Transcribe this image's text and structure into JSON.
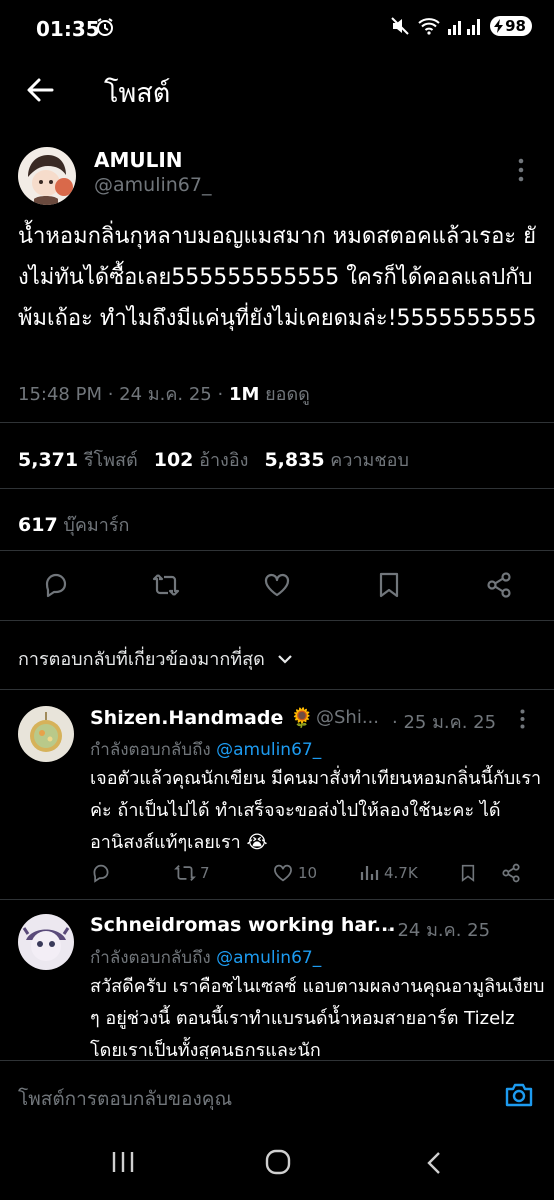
{
  "status_bar": {
    "time": "01:35",
    "battery": "98"
  },
  "header": {
    "title": "โพสต์"
  },
  "post": {
    "author_name": "AMULIN",
    "author_handle": "@amulin67_",
    "text": "น้ำหอมกลิ่นกุหลาบมอญแมสมาก หมดสตอคแล้วเรอะ ยังไม่ทันได้ซื้อเลย555555555555 ใครก็ได้คอลแลปกับพ้มเถ้อะ ทำไมถึงมีแค่นุที่ยังไม่เคยดมล่ะ!5555555555",
    "time": "15:48 PM · 24 ม.ค. 25 ·",
    "views_count": "1M",
    "views_label": "ยอดดู"
  },
  "stats": {
    "reposts_count": "5,371",
    "reposts_label": "รีโพสต์",
    "quotes_count": "102",
    "quotes_label": "อ้างอิง",
    "likes_count": "5,835",
    "likes_label": "ความชอบ",
    "bookmarks_count": "617",
    "bookmarks_label": "บุ๊คมาร์ก"
  },
  "sort_label": "การตอบกลับที่เกี่ยวข้องมากที่สุด",
  "replies": [
    {
      "name": "Shizen.Handmade",
      "emoji": "🌻",
      "handle": "@Shi...",
      "date": "· 25 ม.ค. 25",
      "replying_prefix": "กำลังตอบกลับถึง",
      "replying_to": "@amulin67_",
      "text": "เจอตัวแล้วคุณนักเขียน มีคนมาสั่งทำเทียนหอมกลิ่นนี้กับเราค่ะ ถ้าเป็นไปได้ ทำเสร็จจะขอส่งไปให้ลองใช้นะคะ ได้อานิสงส์แท้ๆเลยเรา 😭",
      "reposts": "7",
      "likes": "10",
      "views": "4.7K"
    },
    {
      "name": "Schneidromas working har...",
      "date": "· 24 ม.ค. 25",
      "replying_prefix": "กำลังตอบกลับถึง",
      "replying_to": "@amulin67_",
      "text": "สวัสดีครับ เราคือชไนเซลซ์ แอบตามผลงานคุณอามูลินเงียบ ๆ อยู่ช่วงนี้  ตอนนี้เราทำแบรนด์น้ำหอมสายอาร์ต Tizelz โดยเราเป็นทั้งสุคนธกรและนัก"
    }
  ],
  "compose": {
    "placeholder": "โพสต์การตอบกลับของคุณ"
  },
  "colors": {
    "background": "#000000",
    "accent": "#1d9bf0",
    "muted": "#71767b",
    "divider": "#2f3336"
  }
}
